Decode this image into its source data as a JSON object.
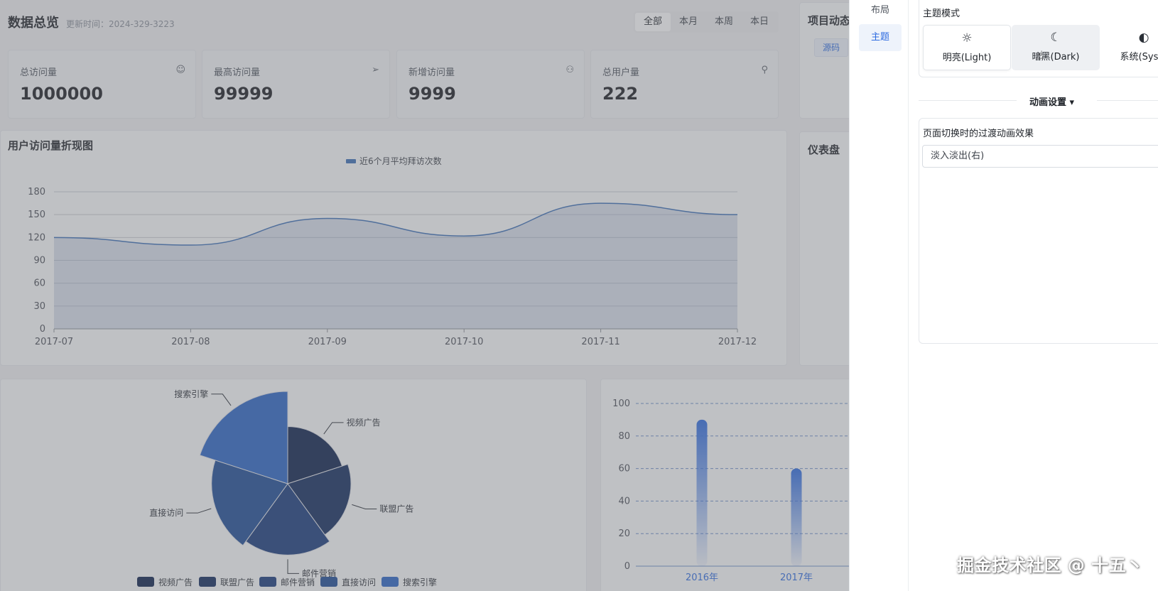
{
  "header": {
    "title": "数据总览",
    "update_time": "更新时间：2024-329-3223",
    "filters": [
      "全部",
      "本月",
      "本周",
      "本日"
    ],
    "active_filter": "全部"
  },
  "stats": [
    {
      "label": "总访问量",
      "value": "1000000",
      "icon": "smile-icon"
    },
    {
      "label": "最高访问量",
      "value": "99999",
      "icon": "send-icon"
    },
    {
      "label": "新增访问量",
      "value": "9999",
      "icon": "user-add-icon"
    },
    {
      "label": "总用户量",
      "value": "222",
      "icon": "user-icon"
    }
  ],
  "side_cards": {
    "project_title": "项目动态",
    "source_tag": "源码",
    "gauge_title": "仪表盘"
  },
  "colors": {
    "line": "#3c6fb6",
    "pie": [
      "#0b1f4a",
      "#102a5c",
      "#173a7a",
      "#1c4a94",
      "#2a64c4"
    ],
    "bar": "#2d6be0",
    "accent": "#2d6be0"
  },
  "line_chart": {
    "title": "用户访问量折现图",
    "chart_data": {
      "type": "area",
      "title": "用户访问量折现图",
      "x": [
        "2017-07",
        "2017-08",
        "2017-09",
        "2017-10",
        "2017-11",
        "2017-12"
      ],
      "series": [
        {
          "name": "近6个月平均拜访次数",
          "values": [
            120,
            110,
            145,
            122,
            165,
            150
          ]
        }
      ],
      "y_ticks": [
        0,
        30,
        60,
        90,
        120,
        150,
        180
      ],
      "ylim": [
        0,
        180
      ],
      "grid": true,
      "legend": "top-center"
    }
  },
  "pie_chart": {
    "chart_data": {
      "type": "pie",
      "categories": [
        "视频广告",
        "联盟广告",
        "邮件营销",
        "直接访问",
        "搜索引擎"
      ],
      "values": [
        18,
        22,
        28,
        32,
        47
      ],
      "rose": true,
      "legend": "bottom",
      "legend_labels": [
        "视频广告",
        "联盟广告",
        "邮件营销",
        "直接访问",
        "搜索引擎"
      ]
    }
  },
  "bar_chart": {
    "chart_data": {
      "type": "bar",
      "categories": [
        "2016年",
        "2017年"
      ],
      "values": [
        90,
        60
      ],
      "y_ticks": [
        0,
        20,
        40,
        60,
        80,
        100
      ],
      "ylim": [
        0,
        100
      ],
      "grid": true
    }
  },
  "drawer": {
    "nav": [
      "布局",
      "主题"
    ],
    "active_nav": "主题",
    "theme_label": "主题模式",
    "theme_options": [
      {
        "label": "明亮(Light)",
        "icon": "sun-icon"
      },
      {
        "label": "暗黑(Dark)",
        "icon": "moon-icon"
      },
      {
        "label": "系统(Syste",
        "icon": "half-circle-icon"
      }
    ],
    "animation_divider": "动画设置",
    "transition_label": "页面切换时的过渡动画效果",
    "transition_value": "淡入淡出(右)"
  },
  "watermark": "掘金技术社区 @ 十五丶"
}
